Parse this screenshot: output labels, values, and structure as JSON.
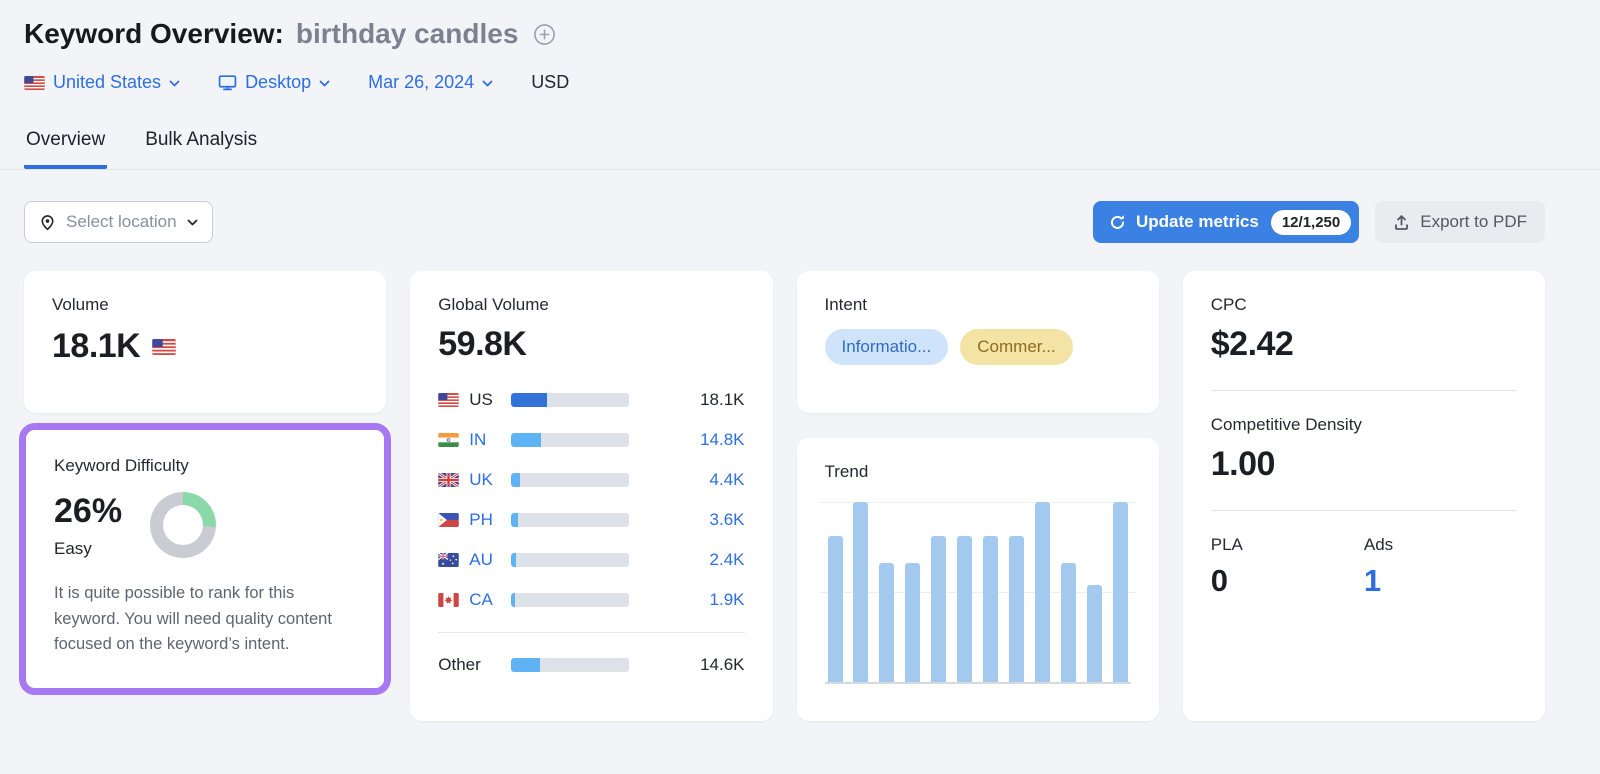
{
  "header": {
    "title": "Keyword Overview:",
    "keyword": "birthday candles",
    "filters": {
      "country": "United States",
      "device": "Desktop",
      "date": "Mar 26, 2024",
      "currency": "USD"
    },
    "tabs": [
      {
        "label": "Overview",
        "active": true
      },
      {
        "label": "Bulk Analysis",
        "active": false
      }
    ]
  },
  "toolbar": {
    "select_location": "Select location",
    "update_metrics": "Update metrics",
    "update_metrics_count": "12/1,250",
    "export_pdf": "Export to PDF"
  },
  "cards": {
    "volume": {
      "label": "Volume",
      "value": "18.1K",
      "flag": "us"
    },
    "keyword_difficulty": {
      "label": "Keyword Difficulty",
      "value": "26%",
      "percent": 26,
      "level": "Easy",
      "description": "It is quite possible to rank for this keyword. You will need quality content focused on the keyword’s intent.",
      "donut_fill": "#8bd8a8",
      "donut_track": "#c9cdd3",
      "highlight_color": "#a678f1"
    },
    "global_volume": {
      "label": "Global Volume",
      "value": "59.8K",
      "bar_dark": "#3273d9",
      "bar_light": "#5fb2f4",
      "rows": [
        {
          "code": "US",
          "flag": "us",
          "value": "18.1K",
          "share": 0.3,
          "emphasis": true
        },
        {
          "code": "IN",
          "flag": "in",
          "value": "14.8K",
          "share": 0.25,
          "emphasis": false
        },
        {
          "code": "UK",
          "flag": "uk",
          "value": "4.4K",
          "share": 0.075,
          "emphasis": false
        },
        {
          "code": "PH",
          "flag": "ph",
          "value": "3.6K",
          "share": 0.06,
          "emphasis": false
        },
        {
          "code": "AU",
          "flag": "au",
          "value": "2.4K",
          "share": 0.04,
          "emphasis": false
        },
        {
          "code": "CA",
          "flag": "ca",
          "value": "1.9K",
          "share": 0.033,
          "emphasis": false
        }
      ],
      "other": {
        "label": "Other",
        "value": "14.6K",
        "share": 0.245
      }
    },
    "intent": {
      "label": "Intent",
      "pills": [
        {
          "text": "Informatio...",
          "bg": "#cfe4fb",
          "color": "#2f6ac8"
        },
        {
          "text": "Commer...",
          "bg": "#f3e3a4",
          "color": "#8f6c20"
        }
      ]
    },
    "trend": {
      "label": "Trend",
      "type": "bar",
      "values": [
        0.81,
        1,
        0.66,
        0.66,
        0.81,
        0.81,
        0.81,
        0.81,
        1,
        0.66,
        0.54,
        1
      ],
      "bar_color": "#a3c9ee"
    },
    "cpc": {
      "label": "CPC",
      "value": "$2.42"
    },
    "competitive_density": {
      "label": "Competitive Density",
      "value": "1.00"
    },
    "pla": {
      "label": "PLA",
      "value": "0"
    },
    "ads": {
      "label": "Ads",
      "value": "1",
      "color": "#2d6ee0"
    }
  }
}
